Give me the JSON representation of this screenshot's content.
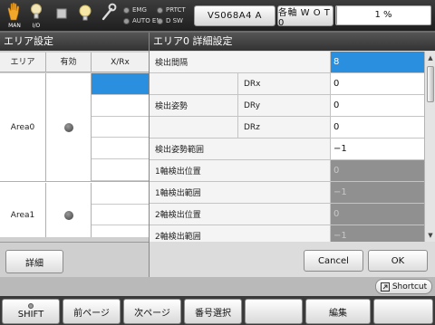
{
  "topbar": {
    "icons": [
      {
        "name": "hand-icon",
        "caption": "MAN"
      },
      {
        "name": "io-lamp-icon",
        "caption": "I/O"
      },
      {
        "name": "stop-icon",
        "caption": ""
      },
      {
        "name": "lamp-icon",
        "caption": ""
      },
      {
        "name": "wrench-icon",
        "caption": ""
      }
    ],
    "leds": {
      "emg": "EMG",
      "prtct": "PRTCT",
      "auto_en": "AUTO EN",
      "d_sw": "D SW"
    },
    "program_button": "VS068A4 A",
    "axis_button": "各軸  W O T 0",
    "progress": {
      "label": "1  %",
      "fraction": 0.01,
      "color": "#46a6e6"
    }
  },
  "left_panel": {
    "title": "エリア設定",
    "columns": [
      "エリア",
      "有効",
      "X/Rx"
    ],
    "areas": [
      {
        "name": "Area0",
        "enabled": false
      },
      {
        "name": "Area1",
        "enabled": false
      }
    ],
    "detail_button": "詳細"
  },
  "dialog": {
    "title": "エリア0 詳細設定",
    "rows": {
      "interval": {
        "label": "検出間隔",
        "value": "8"
      },
      "posture": {
        "label": "検出姿勢"
      },
      "drx": {
        "label": "DRx",
        "value": "0"
      },
      "dry": {
        "label": "DRy",
        "value": "0"
      },
      "drz": {
        "label": "DRz",
        "value": "0"
      },
      "posture_range": {
        "label": "検出姿勢範囲",
        "value": "−1"
      },
      "axis1_pos": {
        "label": "1軸検出位置",
        "value": "0"
      },
      "axis1_range": {
        "label": "1軸検出範囲",
        "value": "−1"
      },
      "axis2_pos": {
        "label": "2軸検出位置",
        "value": "0"
      },
      "axis2_range": {
        "label": "2軸検出範囲",
        "value": "−1"
      }
    },
    "cancel_label": "Cancel",
    "ok_label": "OK"
  },
  "shortcut": {
    "label": "Shortcut"
  },
  "function_keys": {
    "f1": "SHIFT",
    "f2": "前ページ",
    "f3": "次ページ",
    "f4": "番号選択",
    "f5": "",
    "f6": "編集",
    "f7": ""
  },
  "colors": {
    "selection": "#2b8fe0",
    "disabled_value_bg": "#909090",
    "title_bar": "#333333"
  }
}
